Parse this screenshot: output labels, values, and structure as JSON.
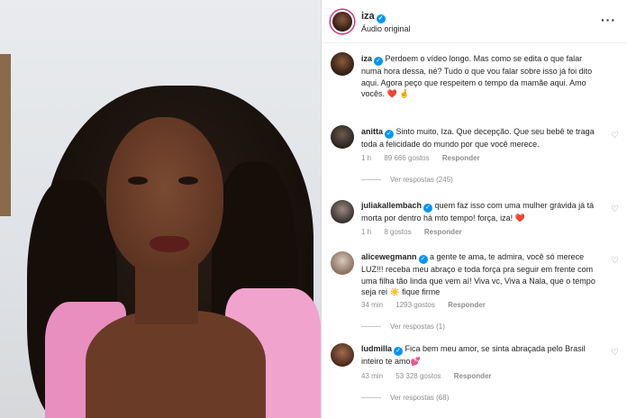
{
  "post": {
    "username": "iza",
    "audio": "Áudio original",
    "more": "···"
  },
  "caption": {
    "username": "iza",
    "text": "Perdoem o vídeo longo. Mas como se edita o que falar numa hora dessa, né? Tudo o que vou falar sobre isso já foi dito aqui. Agora peço que respeitem o tempo da mamãe aqui. Amo vocês.",
    "emoji": "❤️ 🤞"
  },
  "comments": [
    {
      "username": "anitta",
      "text": "Sinto muito, Iza. Que decepção. Que seu bebê te traga toda a felicidade do mundo por que você merece.",
      "time": "1 h",
      "likes": "89 666 gostos",
      "reply": "Responder",
      "replies": "Ver respostas (245)"
    },
    {
      "username": "juliakallembach",
      "text": "quem faz isso com uma mulher grávida já tá morta por dentro há mto tempo! força, iza!",
      "emoji": "❤️",
      "time": "1 h",
      "likes": "8 gostos",
      "reply": "Responder"
    },
    {
      "username": "alicewegmann",
      "text": "a gente te ama, te admira, você só merece LUZ!!! receba meu abraço e toda força pra seguir em frente com uma filha tão linda que vem aí! Viva vc, Viva a Nala, que o tempo seja rei",
      "emoji": "☀️",
      "text2": "fique firme",
      "time": "34 min",
      "likes": "1293 gostos",
      "reply": "Responder",
      "replies": "Ver respostas (1)"
    },
    {
      "username": "ludmilla",
      "text": "Fica bem meu amor, se sinta abraçada pelo Brasil inteiro te amo",
      "emoji": "💕",
      "time": "43 min",
      "likes": "53 328 gostos",
      "reply": "Responder",
      "replies": "Ver respostas (68)"
    }
  ],
  "icons": {
    "verified": "✓",
    "like": "♡"
  },
  "colors": {
    "verified": "#0095f6",
    "story_ring": "#d62976",
    "muted_text": "#8e8e8e",
    "heart_red": "#ed4956"
  }
}
